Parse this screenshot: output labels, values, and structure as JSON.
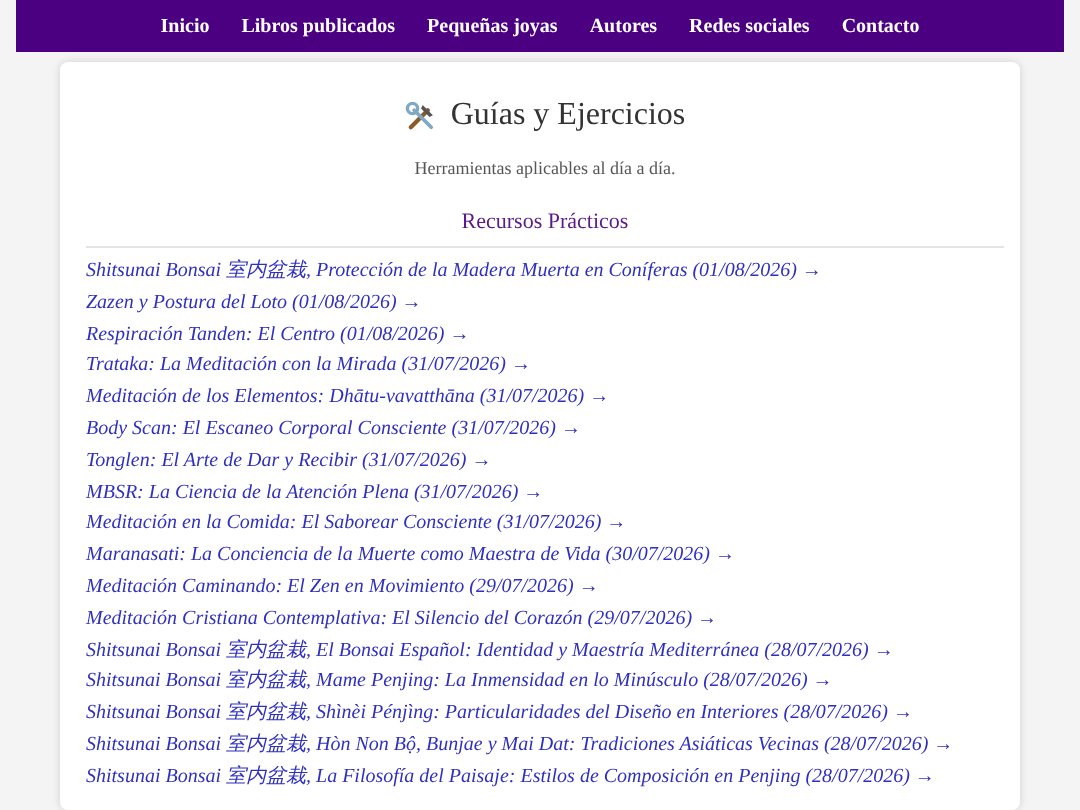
{
  "nav": [
    {
      "label": "Inicio"
    },
    {
      "label": "Libros publicados"
    },
    {
      "label": "Pequeñas joyas"
    },
    {
      "label": "Autores"
    },
    {
      "label": "Redes sociales"
    },
    {
      "label": "Contacto"
    }
  ],
  "page": {
    "title": "Guías y Ejercicios",
    "subtitle": "Herramientas aplicables al día a día."
  },
  "section": {
    "title": "Recursos Prácticos",
    "links": [
      "Shitsunai Bonsai 室内盆栽, Protección de la Madera Muerta en Coníferas (01/08/2026) →",
      "Zazen y Postura del Loto (01/08/2026) →",
      "Respiración Tanden: El Centro (01/08/2026) →",
      "Trataka: La Meditación con la Mirada (31/07/2026) →",
      "Meditación de los Elementos: Dhātu-vavatthāna (31/07/2026) →",
      "Body Scan: El Escaneo Corporal Consciente (31/07/2026) →",
      "Tonglen: El Arte de Dar y Recibir (31/07/2026) →",
      "MBSR: La Ciencia de la Atención Plena (31/07/2026) →",
      "Meditación en la Comida: El Saborear Consciente (31/07/2026) →",
      "Maranasati: La Conciencia de la Muerte como Maestra de Vida (30/07/2026) →",
      "Meditación Caminando: El Zen en Movimiento (29/07/2026) →",
      "Meditación Cristiana Contemplativa: El Silencio del Corazón (29/07/2026) →",
      "Shitsunai Bonsai 室内盆栽, El Bonsai Español: Identidad y Maestría Mediterránea (28/07/2026) →",
      "Shitsunai Bonsai 室内盆栽, Mame Penjing: La Inmensidad en lo Minúsculo (28/07/2026) →",
      "Shitsunai Bonsai 室内盆栽, Shìnèi Pénjìng: Particularidades del Diseño en Interiores (28/07/2026) →",
      "Shitsunai Bonsai 室内盆栽, Hòn Non Bộ, Bunjae y Mai Dat: Tradiciones Asiáticas Vecinas (28/07/2026) →",
      "Shitsunai Bonsai 室内盆栽, La Filosofía del Paisaje: Estilos de Composición en Penjing (28/07/2026) →"
    ]
  }
}
